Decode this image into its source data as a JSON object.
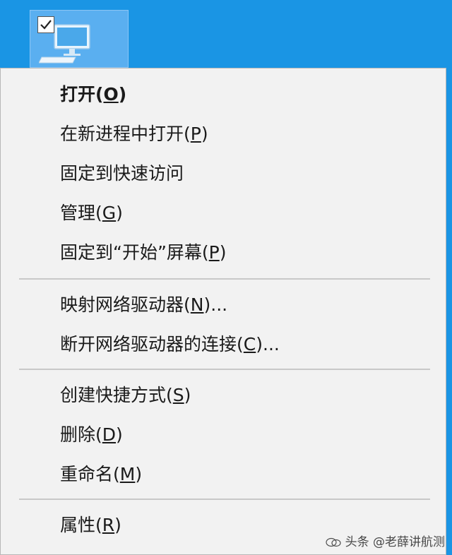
{
  "desktop": {
    "icon_tile": {
      "checked": true,
      "icon": "computer-monitor-icon"
    }
  },
  "context_menu": {
    "groups": [
      {
        "items": [
          {
            "label": "打开",
            "accel": "O",
            "default": true
          },
          {
            "label": "在新进程中打开",
            "accel": "P"
          },
          {
            "label": "固定到快速访问"
          },
          {
            "label": "管理",
            "accel": "G"
          },
          {
            "label": "固定到“开始”屏幕",
            "accel": "P"
          }
        ]
      },
      {
        "items": [
          {
            "label": "映射网络驱动器",
            "accel": "N",
            "suffix": "..."
          },
          {
            "label": "断开网络驱动器的连接",
            "accel": "C",
            "suffix": "..."
          }
        ]
      },
      {
        "items": [
          {
            "label": "创建快捷方式",
            "accel": "S"
          },
          {
            "label": "删除",
            "accel": "D"
          },
          {
            "label": "重命名",
            "accel": "M"
          }
        ]
      },
      {
        "items": [
          {
            "label": "属性",
            "accel": "R"
          }
        ]
      }
    ]
  },
  "watermark": {
    "text": "头条 @老薛讲航测"
  },
  "colors": {
    "desktop_bg": "#1a95e4",
    "menu_bg": "#f2f2f2",
    "menu_text": "#1a1a1a",
    "separator": "#c8c8c8"
  }
}
